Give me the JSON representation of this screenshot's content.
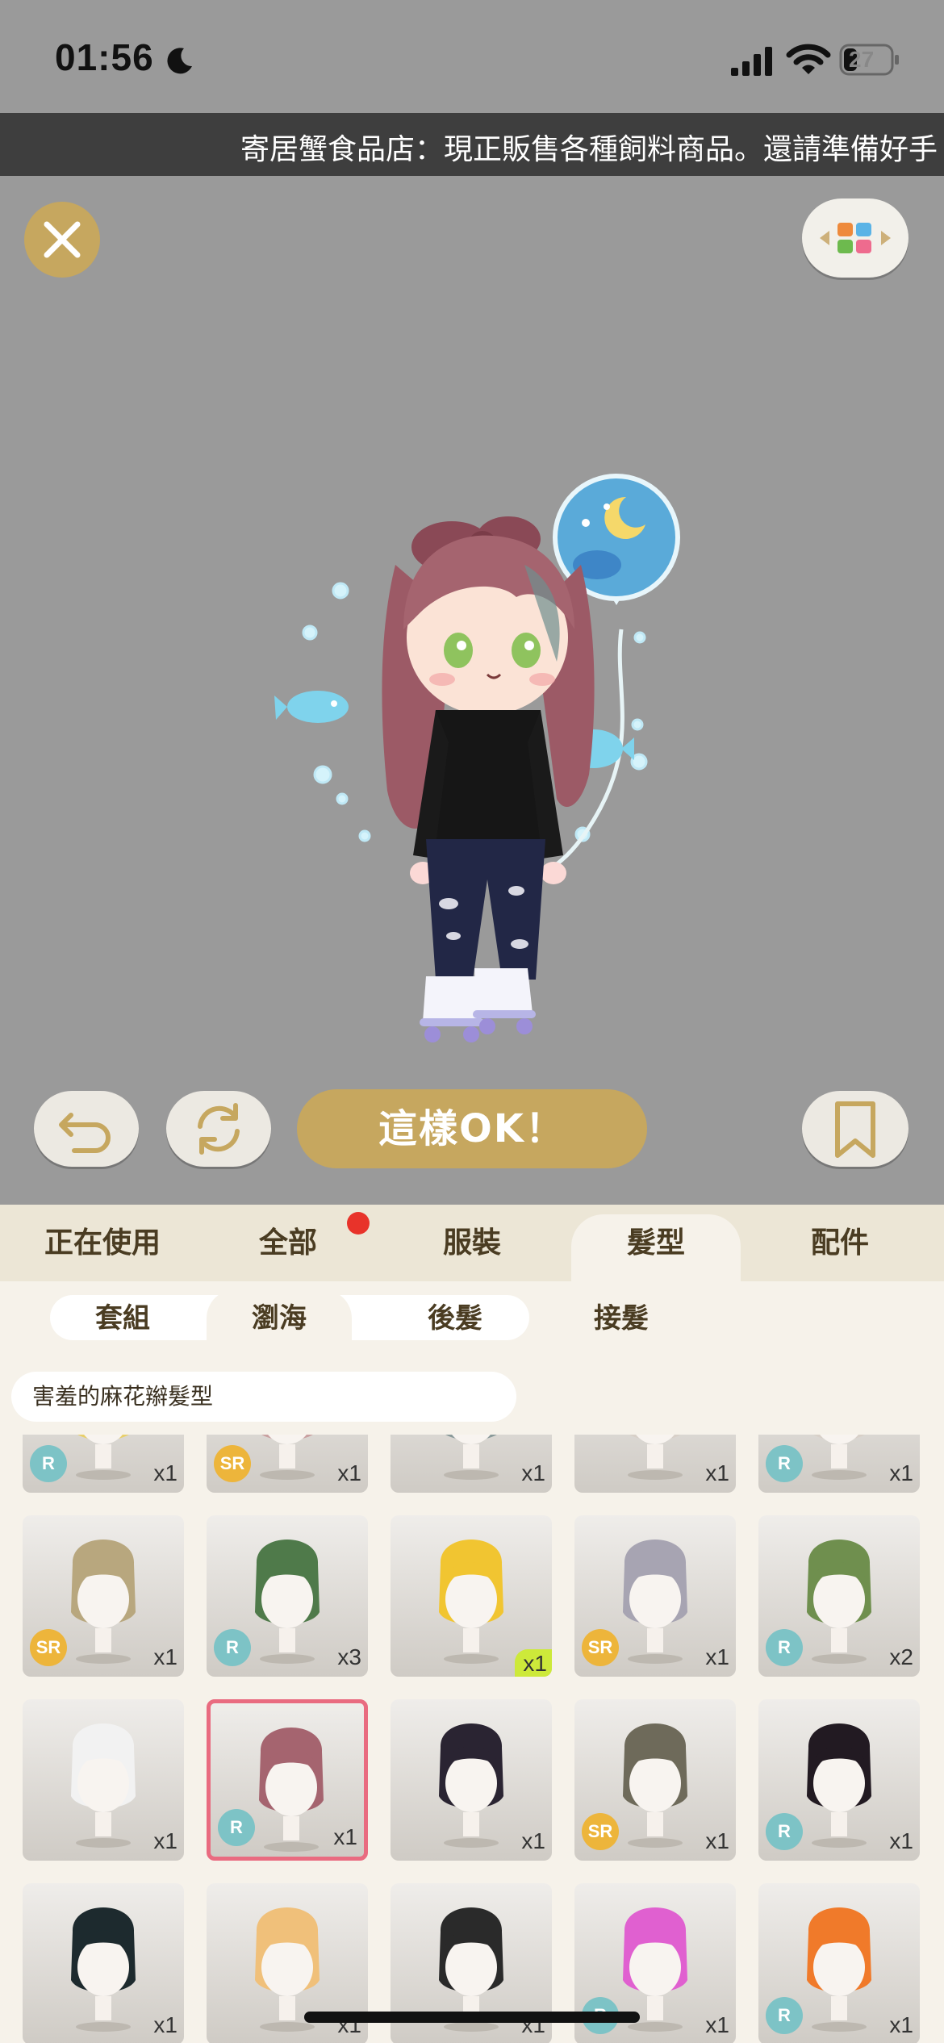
{
  "status": {
    "time": "01:56",
    "battery": "27"
  },
  "ticker": {
    "text": "寄居蟹食品店：現正販售各種飼料商品。還請準備好手"
  },
  "controls": {
    "confirm_label": "這樣OK！"
  },
  "tabs": [
    {
      "label": "正在使用",
      "active": false
    },
    {
      "label": "全部",
      "active": false,
      "notification": true
    },
    {
      "label": "服裝",
      "active": false
    },
    {
      "label": "髮型",
      "active": true
    },
    {
      "label": "配件",
      "active": false
    }
  ],
  "subtabs": [
    {
      "label": "套組",
      "active": false
    },
    {
      "label": "瀏海",
      "active": true
    },
    {
      "label": "後髮",
      "active": false
    },
    {
      "label": "接髮",
      "active": false
    }
  ],
  "selected_item_name": "害羞的麻花辮髮型",
  "colors": {
    "accent_gold": "#c6a75f",
    "selected_border": "#e96b80",
    "rarity_r": "#7dc3c6",
    "rarity_sr": "#edb53b"
  },
  "grid_rows": [
    [
      {
        "rarity": "R",
        "qty": "x1",
        "hair": "#e8cf6a"
      },
      {
        "rarity": "SR",
        "qty": "x1",
        "hair": "#c9a0a0"
      },
      {
        "rarity": "",
        "qty": "x1",
        "hair": "#8a9a9a"
      },
      {
        "rarity": "",
        "qty": "x1",
        "hair": "#d8d0c8"
      },
      {
        "rarity": "R",
        "qty": "x1",
        "hair": "#d8d0c8"
      }
    ],
    [
      {
        "rarity": "SR",
        "qty": "x1",
        "hair": "#b8a77e"
      },
      {
        "rarity": "R",
        "qty": "x3",
        "hair": "#4f7a4a"
      },
      {
        "rarity": "",
        "qty": "x1",
        "hair": "#f1c531",
        "new": true
      },
      {
        "rarity": "SR",
        "qty": "x1",
        "hair": "#a7a4b2"
      },
      {
        "rarity": "R",
        "qty": "x2",
        "hair": "#6f8f4e"
      }
    ],
    [
      {
        "rarity": "",
        "qty": "x1",
        "hair": "#f2f2f2"
      },
      {
        "rarity": "R",
        "qty": "x1",
        "hair": "#a5646f",
        "selected": true
      },
      {
        "rarity": "",
        "qty": "x1",
        "hair": "#2a2432"
      },
      {
        "rarity": "SR",
        "qty": "x1",
        "hair": "#6e6a5a"
      },
      {
        "rarity": "R",
        "qty": "x1",
        "hair": "#221a22"
      }
    ],
    [
      {
        "rarity": "",
        "qty": "x1",
        "hair": "#1d2a2e"
      },
      {
        "rarity": "",
        "qty": "x1",
        "hair": "#f0c07a"
      },
      {
        "rarity": "",
        "qty": "x1",
        "hair": "#2a2a2a"
      },
      {
        "rarity": "R",
        "qty": "x1",
        "hair": "#e060d0"
      },
      {
        "rarity": "R",
        "qty": "x1",
        "hair": "#f07a2a"
      }
    ]
  ]
}
